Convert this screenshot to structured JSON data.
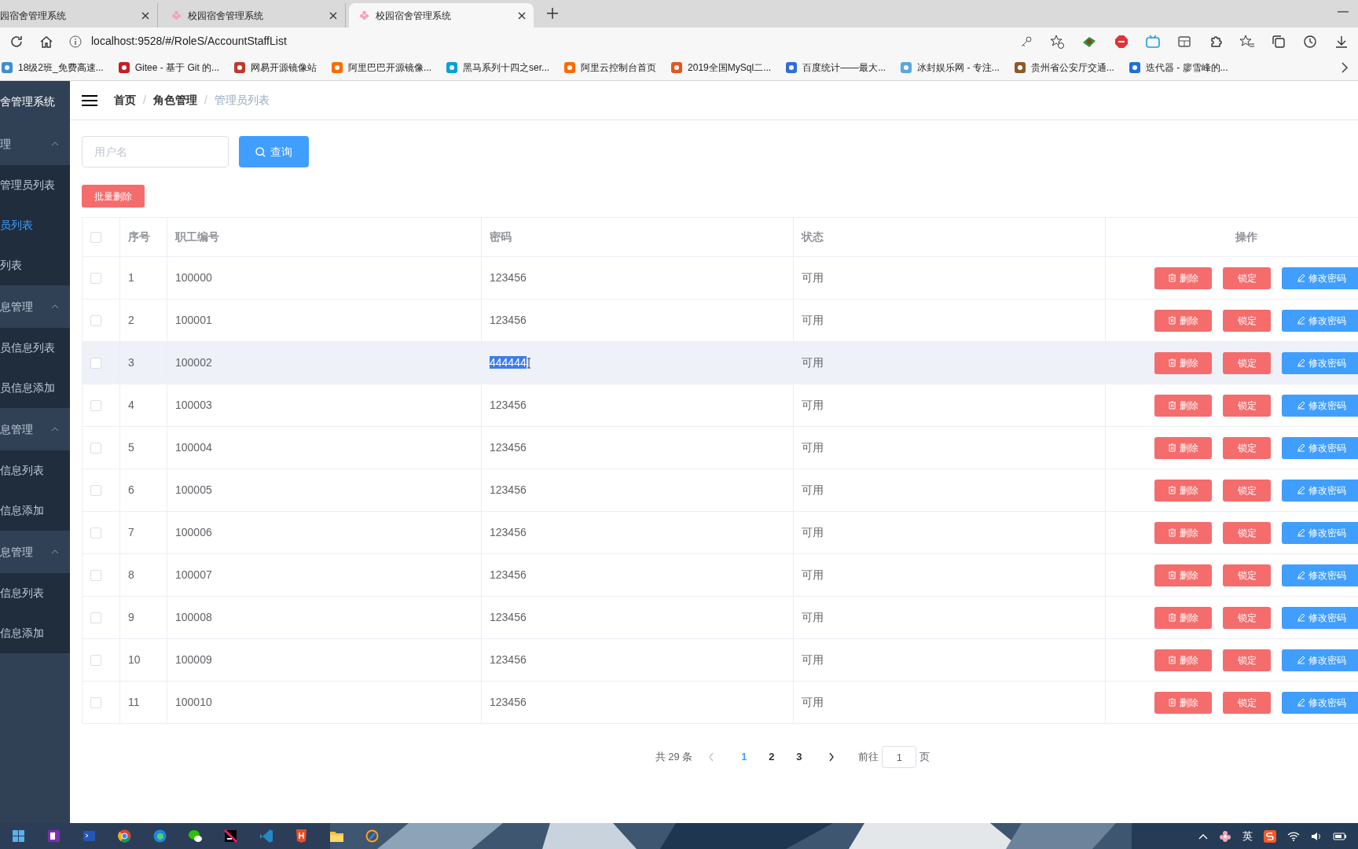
{
  "browser": {
    "tabs": [
      {
        "title": "园宿舍管理系统",
        "selected": false,
        "clipped": true
      },
      {
        "title": "校园宿舍管理系统",
        "selected": false
      },
      {
        "title": "校园宿舍管理系统",
        "selected": true
      }
    ],
    "address": "localhost:9528/#/RoleS/AccountStaffList",
    "bookmarks": [
      "18级2班_免费高速...",
      "Gitee - 基于 Git 的...",
      "网易开源镜像站",
      "阿里巴巴开源镜像...",
      "黑马系列十四之ser...",
      "阿里云控制台首页",
      "2019全国MySql二...",
      "百度统计——最大...",
      "冰封娱乐网 - 专注...",
      "贵州省公安厅交通...",
      "迭代器 - 廖雪峰的..."
    ]
  },
  "sidebar": {
    "title": "舍管理系统",
    "groups": [
      {
        "label": "理",
        "expanded": true,
        "items": [
          {
            "label": "管理员列表",
            "selected": false
          },
          {
            "label": "员列表",
            "selected": true
          },
          {
            "label": "列表",
            "selected": false
          }
        ]
      },
      {
        "label": "息管理",
        "expanded": true,
        "items": [
          {
            "label": "员信息列表",
            "selected": false
          },
          {
            "label": "员信息添加",
            "selected": false
          }
        ]
      },
      {
        "label": "息管理",
        "expanded": true,
        "items": [
          {
            "label": "信息列表",
            "selected": false
          },
          {
            "label": "信息添加",
            "selected": false
          }
        ]
      },
      {
        "label": "息管理",
        "expanded": true,
        "items": [
          {
            "label": "信息列表",
            "selected": false
          },
          {
            "label": "信息添加",
            "selected": false
          }
        ]
      }
    ]
  },
  "breadcrumb": [
    {
      "label": "首页",
      "current": false
    },
    {
      "separator": "/",
      "label": "角色管理",
      "current": false
    },
    {
      "separator": "/",
      "label": "管理员列表",
      "current": true
    }
  ],
  "search": {
    "placeholder": "用户名",
    "button": "查询"
  },
  "batch_delete": "批量删除",
  "table": {
    "columns": [
      "序号",
      "职工编号",
      "密码",
      "状态",
      "操作"
    ],
    "header_checked": false,
    "rows": [
      {
        "checked": false,
        "hovered": false,
        "text_selected": false,
        "cells": [
          "1",
          "100000",
          "123456",
          "可用"
        ],
        "actions": [
          "删除",
          "锁定",
          "修改密码"
        ]
      },
      {
        "checked": false,
        "hovered": false,
        "text_selected": false,
        "cells": [
          "2",
          "100001",
          "123456",
          "可用"
        ],
        "actions": [
          "删除",
          "锁定",
          "修改密码"
        ]
      },
      {
        "checked": false,
        "hovered": true,
        "text_selected": true,
        "cells": [
          "3",
          "100002",
          "444444",
          "可用"
        ],
        "actions": [
          "删除",
          "锁定",
          "修改密码"
        ]
      },
      {
        "checked": false,
        "hovered": false,
        "text_selected": false,
        "cells": [
          "4",
          "100003",
          "123456",
          "可用"
        ],
        "actions": [
          "删除",
          "锁定",
          "修改密码"
        ]
      },
      {
        "checked": false,
        "hovered": false,
        "text_selected": false,
        "cells": [
          "5",
          "100004",
          "123456",
          "可用"
        ],
        "actions": [
          "删除",
          "锁定",
          "修改密码"
        ]
      },
      {
        "checked": false,
        "hovered": false,
        "text_selected": false,
        "cells": [
          "6",
          "100005",
          "123456",
          "可用"
        ],
        "actions": [
          "删除",
          "锁定",
          "修改密码"
        ]
      },
      {
        "checked": false,
        "hovered": false,
        "text_selected": false,
        "cells": [
          "7",
          "100006",
          "123456",
          "可用"
        ],
        "actions": [
          "删除",
          "锁定",
          "修改密码"
        ]
      },
      {
        "checked": false,
        "hovered": false,
        "text_selected": false,
        "cells": [
          "8",
          "100007",
          "123456",
          "可用"
        ],
        "actions": [
          "删除",
          "锁定",
          "修改密码"
        ]
      },
      {
        "checked": false,
        "hovered": false,
        "text_selected": false,
        "cells": [
          "9",
          "100008",
          "123456",
          "可用"
        ],
        "actions": [
          "删除",
          "锁定",
          "修改密码"
        ]
      },
      {
        "checked": false,
        "hovered": false,
        "text_selected": false,
        "cells": [
          "10",
          "100009",
          "123456",
          "可用"
        ],
        "actions": [
          "删除",
          "锁定",
          "修改密码"
        ]
      },
      {
        "checked": false,
        "hovered": false,
        "text_selected": false,
        "cells": [
          "11",
          "100010",
          "123456",
          "可用"
        ],
        "actions": [
          "删除",
          "锁定",
          "修改密码"
        ]
      }
    ]
  },
  "pagination": {
    "total": "共 29 条",
    "pages": [
      {
        "label": "1",
        "selected": true
      },
      {
        "label": "2",
        "selected": false
      },
      {
        "label": "3",
        "selected": false
      }
    ],
    "goto_label": "前往",
    "goto_value": "1",
    "goto_suffix": "页"
  },
  "taskbar": {
    "ime": "英"
  }
}
